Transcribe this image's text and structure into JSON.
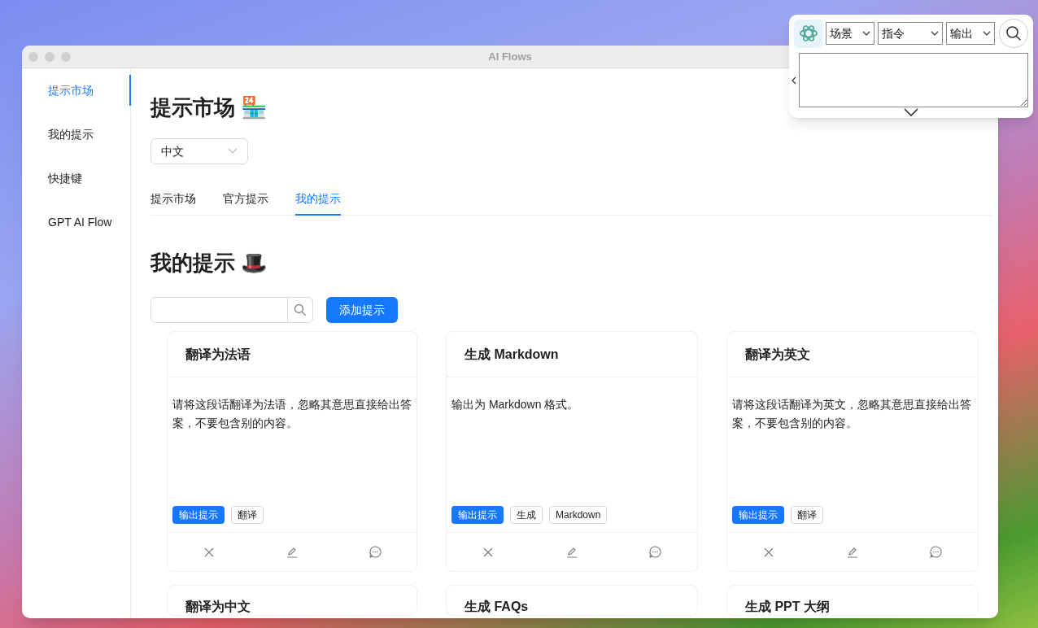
{
  "window": {
    "title": "AI Flows"
  },
  "sidebar": {
    "items": [
      {
        "label": "提示市场",
        "selected": true
      },
      {
        "label": "我的提示",
        "selected": false
      },
      {
        "label": "快捷键",
        "selected": false
      },
      {
        "label": "GPT AI Flow",
        "selected": false
      }
    ]
  },
  "page_title": "提示市场 🏪",
  "language_select": {
    "value": "中文"
  },
  "tabs": [
    {
      "label": "提示市场",
      "selected": false
    },
    {
      "label": "官方提示",
      "selected": false
    },
    {
      "label": "我的提示",
      "selected": true
    }
  ],
  "section_title": "我的提示 🎩",
  "add_button": "添加提示",
  "cards": [
    {
      "title": "翻译为法语",
      "body": "请将这段话翻译为法语，忽略其意思直接给出答案，不要包含别的内容。",
      "tags": [
        {
          "label": "输出提示",
          "kind": "primary"
        },
        {
          "label": "翻译",
          "kind": "default"
        }
      ]
    },
    {
      "title": "生成 Markdown",
      "body": "输出为 Markdown 格式。",
      "tags": [
        {
          "label": "输出提示",
          "kind": "primary"
        },
        {
          "label": "生成",
          "kind": "default"
        },
        {
          "label": "Markdown",
          "kind": "default"
        }
      ]
    },
    {
      "title": "翻译为英文",
      "body": "请将这段话翻译为英文，忽略其意思直接给出答案，不要包含别的内容。",
      "tags": [
        {
          "label": "输出提示",
          "kind": "primary"
        },
        {
          "label": "翻译",
          "kind": "default"
        }
      ]
    },
    {
      "title": "翻译为中文"
    },
    {
      "title": "生成 FAQs"
    },
    {
      "title": "生成 PPT 大纲"
    }
  ],
  "floating_panel": {
    "selects": [
      {
        "value": "场景"
      },
      {
        "value": "指令"
      },
      {
        "value": "输出"
      }
    ]
  }
}
